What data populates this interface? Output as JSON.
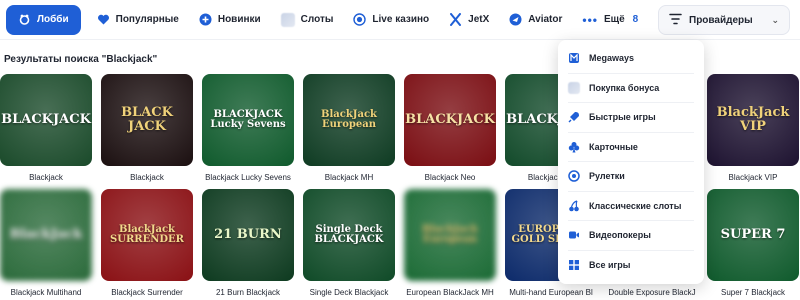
{
  "nav": {
    "items": [
      {
        "label": "Лобби",
        "icon": "lobby-icon",
        "active": true
      },
      {
        "label": "Популярные",
        "icon": "heart-icon"
      },
      {
        "label": "Новинки",
        "icon": "plus-circle-icon"
      },
      {
        "label": "Слоты",
        "icon": "slots-icon"
      },
      {
        "label": "Live казино",
        "icon": "live-icon"
      },
      {
        "label": "JetX",
        "icon": "jetx-icon"
      },
      {
        "label": "Aviator",
        "icon": "aviator-icon"
      }
    ],
    "more_label": "Ещё",
    "more_count": "8",
    "providers_label": "Провайдеры"
  },
  "search": {
    "heading": "Результаты поиска \"Blackjack\""
  },
  "games": [
    {
      "label": "Blackjack",
      "bg": "#1a4a2a",
      "logo": "BLACKJACK",
      "color": "#ffffff"
    },
    {
      "label": "Blackjack",
      "bg": "#1b0f10",
      "logo": "BLACK JACK",
      "color": "#f0d27a"
    },
    {
      "label": "Blackjack Lucky Sevens",
      "bg": "#0f5a2c",
      "logo": "BLACKJACK Lucky Sevens",
      "color": "#ffffff"
    },
    {
      "label": "Blackjack MH",
      "bg": "#0e3b22",
      "logo": "BlackJack European",
      "color": "#f0d27a"
    },
    {
      "label": "Blackjack Neo",
      "bg": "#7a0d12",
      "logo": "BLACKJACK",
      "color": "#f7e2a6"
    },
    {
      "label": "Blackjack Ro",
      "bg": "#124a2a",
      "logo": "BLACKJACK",
      "color": "#ffffff"
    },
    {
      "label": "",
      "bg": "#ffffff",
      "logo": "",
      "color": "#ffffff"
    },
    {
      "label": "Blackjack VIP",
      "bg": "#1d1230",
      "logo": "BlackJack VIP",
      "color": "#f0d27a"
    },
    {
      "label": "Blackjack Multihand",
      "bg": "#2a6a3a",
      "logo": "BlackJack",
      "color": "#ffffff"
    },
    {
      "label": "Blackjack Surrender",
      "bg": "#8a1014",
      "logo": "BlackJack SURRENDER",
      "color": "#f3d98c"
    },
    {
      "label": "21 Burn Blackjack",
      "bg": "#0d3a1f",
      "logo": "21 BURN",
      "color": "#e9f7c9"
    },
    {
      "label": "Single Deck Blackjack",
      "bg": "#0f4a27",
      "logo": "Single Deck BLACKJACK",
      "color": "#ffffff"
    },
    {
      "label": "European BlackJack MH",
      "bg": "#1a6a34",
      "logo": "BlackJack European",
      "color": "#f0d27a"
    },
    {
      "label": "Multi-hand European Bl",
      "bg": "#0c2a6a",
      "logo": "EUROPEAN GOLD SERIES",
      "color": "#f3d98c"
    },
    {
      "label": "Double Exposure BlackJ",
      "bg": "#ffffff",
      "logo": "",
      "color": "#ffffff"
    },
    {
      "label": "Super 7 Blackjack",
      "bg": "#0f5a2c",
      "logo": "SUPER 7",
      "color": "#ffffff"
    }
  ],
  "providers_menu": [
    {
      "label": "Megaways",
      "icon": "megaways-icon"
    },
    {
      "label": "Покупка бонуса",
      "icon": "bonus-icon"
    },
    {
      "label": "Быстрые игры",
      "icon": "rocket-icon"
    },
    {
      "label": "Карточные",
      "icon": "club-icon"
    },
    {
      "label": "Рулетки",
      "icon": "roulette-icon"
    },
    {
      "label": "Классические слоты",
      "icon": "cherry-icon"
    },
    {
      "label": "Видеопокеры",
      "icon": "video-icon"
    },
    {
      "label": "Все игры",
      "icon": "grid-icon"
    }
  ],
  "colors": {
    "accent": "#1f5fd6",
    "text": "#1f2430"
  }
}
